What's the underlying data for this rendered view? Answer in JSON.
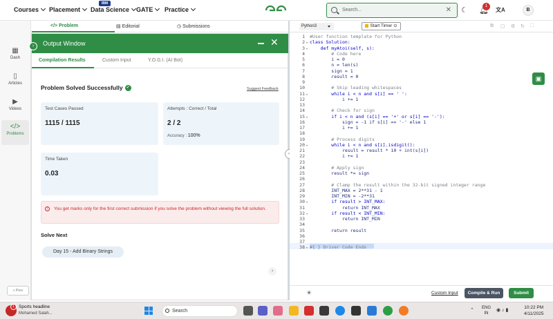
{
  "nav": {
    "items": [
      "Courses",
      "Placement",
      "Data Science",
      "GATE",
      "Practice"
    ],
    "ibm_badge": "IBM",
    "logo_text": "GfG",
    "search_placeholder": "Search...",
    "notification_count": "1",
    "avatar_initial": "B"
  },
  "rail": {
    "items": [
      {
        "label": "Dash",
        "icon": "dashboard-icon"
      },
      {
        "label": "Articles",
        "icon": "book-icon"
      },
      {
        "label": "Videos",
        "icon": "video-icon"
      },
      {
        "label": "Problems",
        "icon": "code-icon"
      }
    ],
    "prev_label": "« Prev"
  },
  "problem_tabs": [
    {
      "label": "</> Problem",
      "active": true
    },
    {
      "label": "Editorial"
    },
    {
      "label": "Submissions"
    }
  ],
  "output": {
    "title": "Output Window",
    "tabs": [
      "Compilation Results",
      "Custom Input",
      "Y.O.G.I. (AI Bot)"
    ],
    "status": "Problem Solved Successfully",
    "suggest": "Suggest Feedback",
    "test_cases_label": "Test Cases Passed",
    "test_cases_value": "1115 / 1115",
    "attempts_label": "Attempts : Correct / Total",
    "attempts_value": "2 / 2",
    "accuracy_label": "Accuracy :",
    "accuracy_value": "100%",
    "time_label": "Time Taken",
    "time_value": "0.03",
    "warning": "You get marks only for the first correct submission if you solve the problem without viewing the full solution.",
    "solve_next_label": "Solve Next",
    "next_problem": "Day 15 - Add Binary Strings"
  },
  "editor": {
    "language": "Python3",
    "timer_label": "Start Timer",
    "lines": [
      {
        "n": "1",
        "t": "#User function template for Python",
        "c": "cm"
      },
      {
        "n": "2",
        "t": "class Solution:",
        "c": "kw",
        "f": true
      },
      {
        "n": "3",
        "t": "    def myAtoi(self, s):",
        "c": "kw",
        "f": true
      },
      {
        "n": "4",
        "t": "        # Code here",
        "c": "cm"
      },
      {
        "n": "5",
        "t": "        i = 0",
        "c": ""
      },
      {
        "n": "6",
        "t": "        n = len(s)",
        "c": ""
      },
      {
        "n": "7",
        "t": "        sign = 1",
        "c": ""
      },
      {
        "n": "8",
        "t": "        result = 0",
        "c": ""
      },
      {
        "n": "9",
        "t": "",
        "c": ""
      },
      {
        "n": "10",
        "t": "        # Skip leading whitespaces",
        "c": "cm"
      },
      {
        "n": "11",
        "t": "        while i < n and s[i] == ' ':",
        "c": "kw",
        "f": true
      },
      {
        "n": "12",
        "t": "            i += 1",
        "c": ""
      },
      {
        "n": "13",
        "t": "",
        "c": ""
      },
      {
        "n": "14",
        "t": "        # Check for sign",
        "c": "cm"
      },
      {
        "n": "15",
        "t": "        if i < n and (s[i] == '+' or s[i] == '-'):",
        "c": "kw",
        "f": true
      },
      {
        "n": "16",
        "t": "            sign = -1 if s[i] == '-' else 1",
        "c": ""
      },
      {
        "n": "17",
        "t": "            i += 1",
        "c": ""
      },
      {
        "n": "18",
        "t": "",
        "c": ""
      },
      {
        "n": "19",
        "t": "        # Process digits",
        "c": "cm"
      },
      {
        "n": "20",
        "t": "        while i < n and s[i].isdigit():",
        "c": "kw",
        "f": true
      },
      {
        "n": "21",
        "t": "            result = result * 10 + int(s[i])",
        "c": ""
      },
      {
        "n": "22",
        "t": "            i += 1",
        "c": ""
      },
      {
        "n": "23",
        "t": "",
        "c": ""
      },
      {
        "n": "24",
        "t": "        # Apply sign",
        "c": "cm"
      },
      {
        "n": "25",
        "t": "        result *= sign",
        "c": ""
      },
      {
        "n": "26",
        "t": "",
        "c": ""
      },
      {
        "n": "27",
        "t": "        # Clamp the result within the 32-bit signed integer range",
        "c": "cm"
      },
      {
        "n": "28",
        "t": "        INT_MAX = 2**31 - 1",
        "c": ""
      },
      {
        "n": "29",
        "t": "        INT_MIN = -2**31",
        "c": ""
      },
      {
        "n": "30",
        "t": "        if result > INT_MAX:",
        "c": "kw",
        "f": true
      },
      {
        "n": "31",
        "t": "            return INT_MAX",
        "c": ""
      },
      {
        "n": "32",
        "t": "        if result < INT_MIN:",
        "c": "kw",
        "f": true
      },
      {
        "n": "33",
        "t": "            return INT_MIN",
        "c": ""
      },
      {
        "n": "34",
        "t": "",
        "c": ""
      },
      {
        "n": "35",
        "t": "        return result",
        "c": ""
      },
      {
        "n": "36",
        "t": "",
        "c": ""
      },
      {
        "n": "37",
        "t": "",
        "c": ""
      },
      {
        "n": "38",
        "t": "#{ } Driver Code Ends",
        "c": "cm",
        "f": true
      }
    ],
    "custom_input": "Custom Input",
    "compile_run": "Compile & Run",
    "submit": "Submit"
  },
  "taskbar": {
    "news_title": "Sports headline",
    "news_sub": "Mohamed Salah...",
    "news_badge": "1",
    "search_placeholder": "Search",
    "lang_top": "ENG",
    "lang_bottom": "IN",
    "time": "10:22 PM",
    "date": "4/11/2025"
  },
  "colors": {
    "brand_green": "#2f8d46",
    "error_red": "#c62828"
  }
}
